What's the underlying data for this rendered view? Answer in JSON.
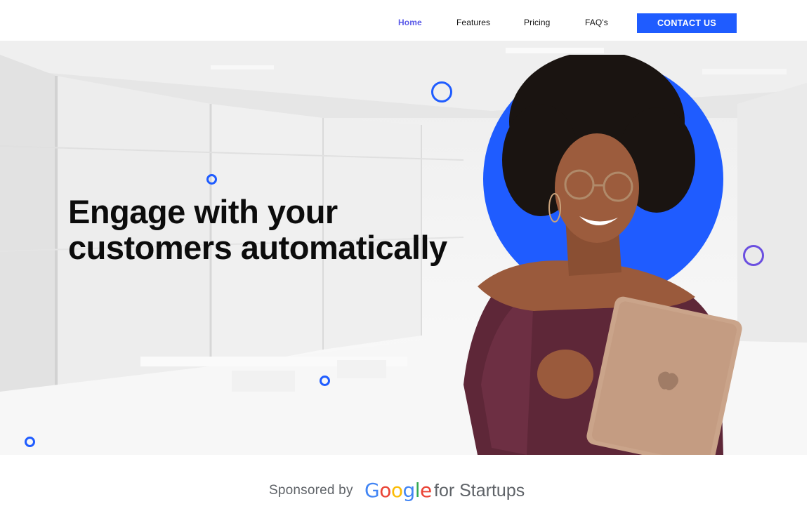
{
  "nav": {
    "links": [
      "Home",
      "Features",
      "Pricing",
      "FAQ's"
    ],
    "active": "Home",
    "contact_label": "CONTACT US"
  },
  "hero": {
    "title_line1": "Engage with your",
    "title_line2": "customers automatically"
  },
  "sponsor": {
    "prefix": "Sponsored by",
    "logo_letters": [
      "G",
      "o",
      "o",
      "g",
      "l",
      "e"
    ],
    "suffix": "for Startups"
  },
  "colors": {
    "accent_blue": "#1f5cff",
    "active_nav": "#5a5ae8",
    "ring_purple": "#6b4fe0",
    "google_blue": "#4285f4",
    "google_red": "#ea4335",
    "google_yellow": "#fbbc05",
    "google_green": "#34a853"
  },
  "icons": [
    "ring-decoration",
    "blue-circle-backdrop",
    "tablet-apple-logo"
  ]
}
